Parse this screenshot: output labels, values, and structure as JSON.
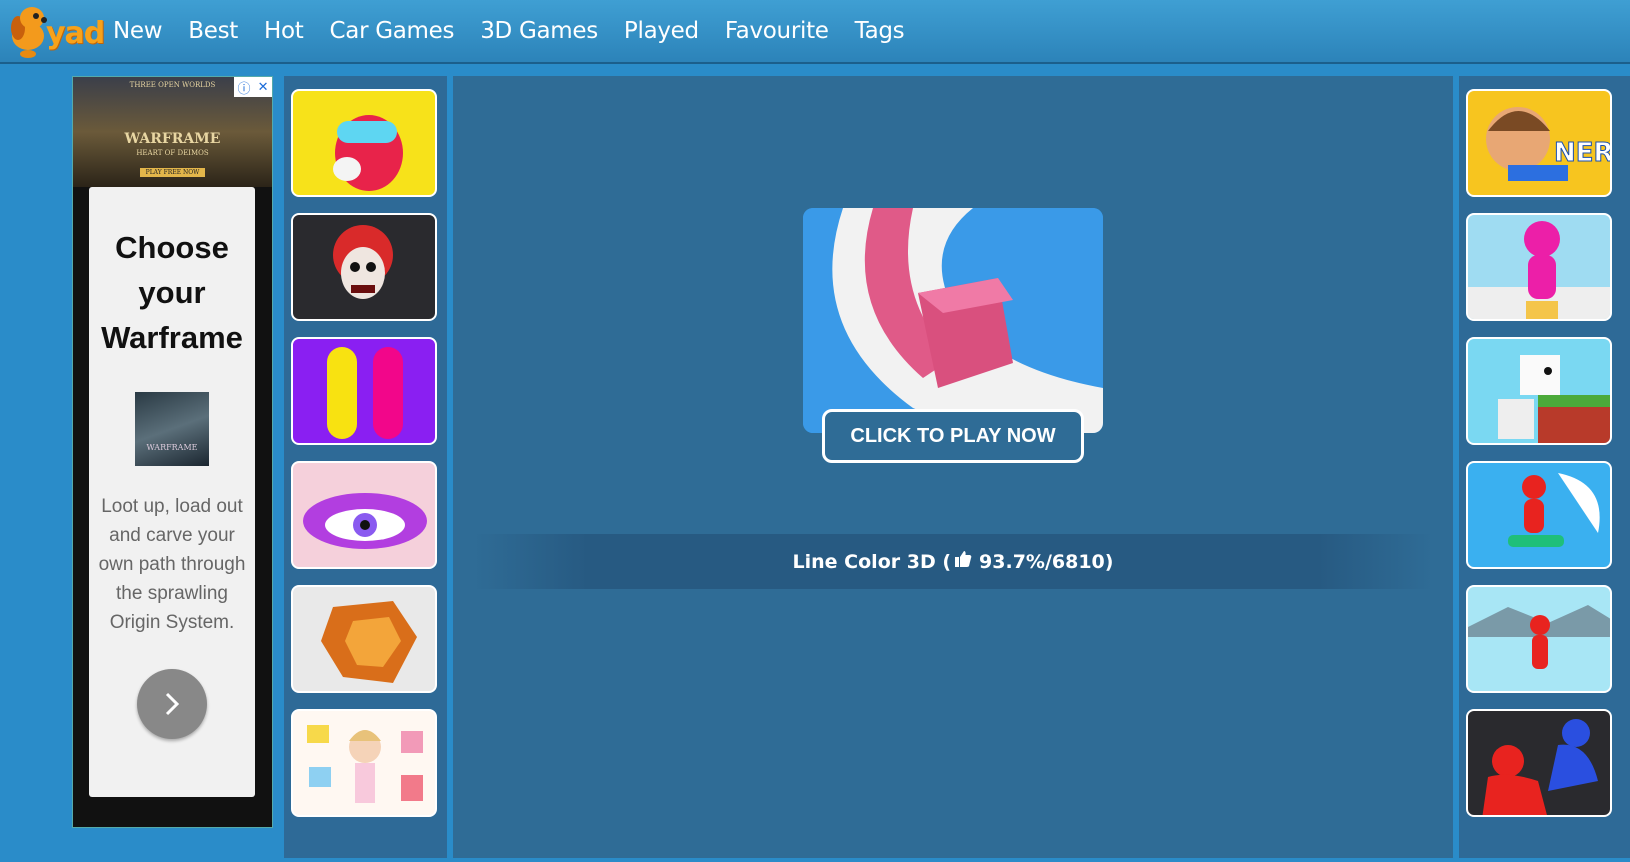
{
  "brand": {
    "logo_text": "yad"
  },
  "nav": [
    {
      "label": "New"
    },
    {
      "label": "Best"
    },
    {
      "label": "Hot"
    },
    {
      "label": "Car Games"
    },
    {
      "label": "3D Games"
    },
    {
      "label": "Played"
    },
    {
      "label": "Favourite"
    },
    {
      "label": "Tags"
    }
  ],
  "ad": {
    "banner_top": "THREE OPEN WORLDS",
    "banner_brand": "WARFRAME",
    "banner_sub": "HEART OF DEIMOS",
    "banner_cta": "PLAY FREE NOW",
    "title": "Choose your Warframe",
    "thumb_text": "WARFRAME",
    "body": "Loot up, load out and carve your own path through the sprawling Origin System."
  },
  "game": {
    "play_label": "CLICK TO PLAY NOW",
    "name": "Line Color 3D",
    "rating": "93.7%/6810"
  },
  "left_thumbs": [
    "among-us-style",
    "scary-clown",
    "color-pills",
    "eye-makeup",
    "low-poly-lion",
    "doll-dress-up"
  ],
  "right_thumbs": [
    "nerf-kid",
    "pink-runner",
    "chicken-cube",
    "wave-surfer",
    "ice-runner",
    "red-blue-fight"
  ]
}
